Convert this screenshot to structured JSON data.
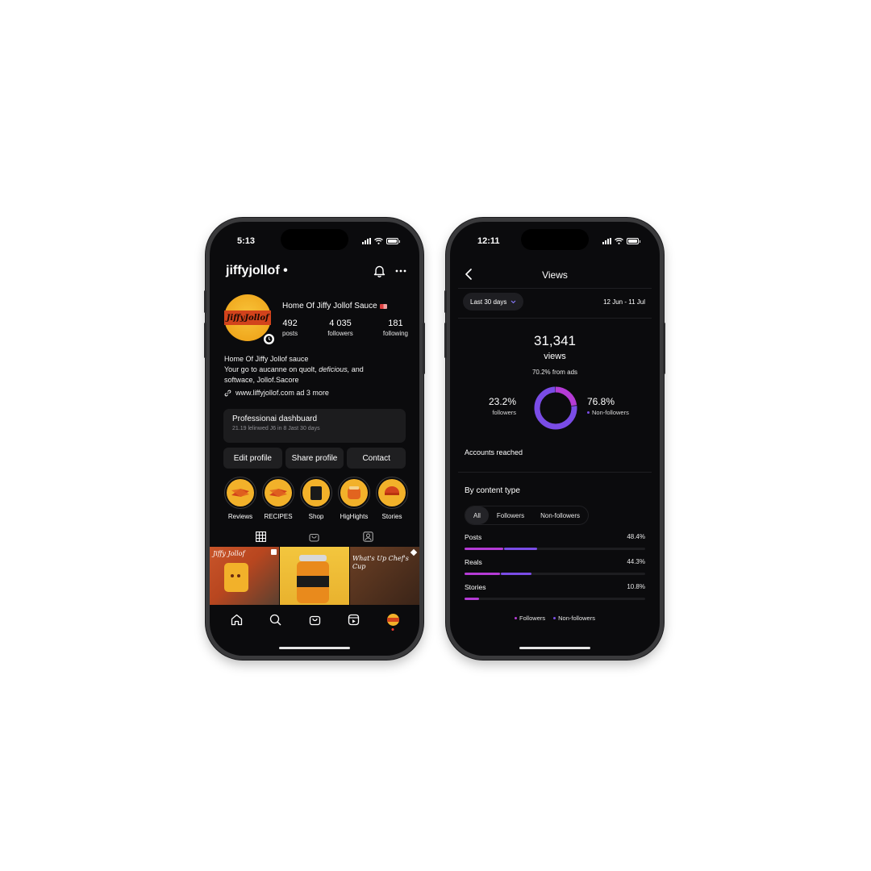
{
  "colors": {
    "phone_frame": "#3a3a3c",
    "screen_bg": "#0b0b0d",
    "accent_orange": "#f2b12a",
    "brand_red": "#d2431c",
    "followers_purple": "#b53bd6",
    "nonfollowers_purple": "#7a4ce6"
  },
  "left_phone": {
    "status_time": "5:13",
    "handle": "jiffyjollof",
    "handle_dot": "•",
    "avatar_logo_text": "JiffyJollof",
    "display_name": "Home Of Jiffy Jollof Sauce",
    "stats": [
      {
        "value": "492",
        "label": "posts"
      },
      {
        "value": "4 035",
        "label": "followers"
      },
      {
        "value": "181",
        "label": "following"
      }
    ],
    "bio": {
      "line1": "Home Of Jiffy Jollof sauce",
      "line2_a": "Your go to aucanne on quolt, ",
      "line2_em": "deficious,",
      "line2_b": " and",
      "line3": "softwace, Jollof.Sacore",
      "link": "www.liffyjollof.com ad 3 more"
    },
    "dashboard": {
      "title": "Professionai dashbuard",
      "subtitle": "21.19 lelinwed J6 in 8 Jast 30 days"
    },
    "actions": [
      "Edit profile",
      "Share profile",
      "Contact"
    ],
    "highlights": [
      {
        "label": "Reviews",
        "icon": "sauce-sachet-icon"
      },
      {
        "label": "RECIPES",
        "icon": "sauce-sachet-icon"
      },
      {
        "label": "Shop",
        "icon": "shopping-bag-icon"
      },
      {
        "label": "HigHights",
        "icon": "jar-icon"
      },
      {
        "label": "Stories",
        "icon": "bowl-icon"
      }
    ],
    "tabs": [
      "grid-icon",
      "shop-icon",
      "tagged-icon"
    ],
    "grid_tiles": [
      {
        "caption": "Jiffy Jollof",
        "bg": "#c9552a"
      },
      {
        "caption": "",
        "bg": "#f0c23a"
      },
      {
        "caption": "What's Up Chef's Cup",
        "bg": "#5a3420"
      }
    ],
    "nav": [
      "home-icon",
      "search-icon",
      "shop-icon",
      "reels-icon",
      "profile-avatar"
    ]
  },
  "right_phone": {
    "status_time": "12:11",
    "title": "Views",
    "filter_label": "Last 30 days",
    "date_range": "12 Jun - 11 Jul",
    "total_views": "31,341",
    "total_label": "views",
    "ads_note": "70.2% from ads",
    "followers_pct_text": "23.2%",
    "followers_label": "followers",
    "nonfollowers_pct_text": "76.8%",
    "nonfollowers_label": "Non-followers",
    "accounts_reached": "Accounts reached",
    "section_title": "By content type",
    "segments": [
      "All",
      "Followers",
      "Non-followers"
    ],
    "legend": [
      "Followers",
      "Non-followers"
    ]
  },
  "chart_data": [
    {
      "type": "pie",
      "categories": [
        "followers",
        "Non-followers"
      ],
      "values": [
        23.2,
        76.8
      ]
    },
    {
      "type": "bar",
      "categories": [
        "Posts",
        "Reals",
        "Stories"
      ],
      "values": [
        48.4,
        44.3,
        10.8
      ],
      "value_labels": [
        "48.4%",
        "44.3%",
        "10.8%"
      ],
      "legend": [
        "Followers",
        "Non-followers"
      ]
    }
  ]
}
